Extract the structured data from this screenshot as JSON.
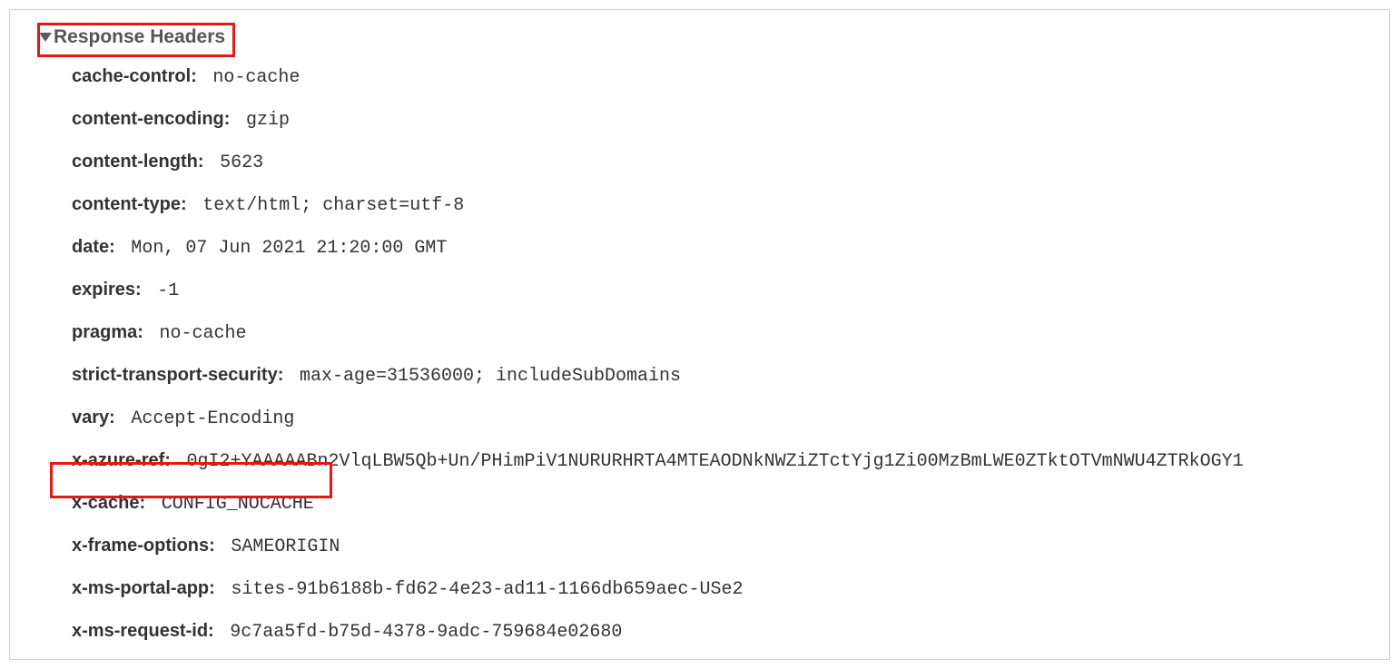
{
  "section": {
    "title": "Response Headers"
  },
  "headers": {
    "h0": {
      "name": "cache-control:",
      "value": "no-cache"
    },
    "h1": {
      "name": "content-encoding:",
      "value": "gzip"
    },
    "h2": {
      "name": "content-length:",
      "value": "5623"
    },
    "h3": {
      "name": "content-type:",
      "value": "text/html; charset=utf-8"
    },
    "h4": {
      "name": "date:",
      "value": "Mon, 07 Jun 2021 21:20:00 GMT"
    },
    "h5": {
      "name": "expires:",
      "value": "-1"
    },
    "h6": {
      "name": "pragma:",
      "value": "no-cache"
    },
    "h7": {
      "name": "strict-transport-security:",
      "value": "max-age=31536000; includeSubDomains"
    },
    "h8": {
      "name": "vary:",
      "value": "Accept-Encoding"
    },
    "h9": {
      "name": "x-azure-ref:",
      "value": "0gI2+YAAAAABn2VlqLBW5Qb+Un/PHimPiV1NURURHRTA4MTEAODNkNWZiZTctYjg1Zi00MzBmLWE0ZTktOTVmNWU4ZTRkOGY1"
    },
    "h10": {
      "name": "x-cache:",
      "value": "CONFIG_NOCACHE"
    },
    "h11": {
      "name": "x-frame-options:",
      "value": "SAMEORIGIN"
    },
    "h12": {
      "name": "x-ms-portal-app:",
      "value": "sites-91b6188b-fd62-4e23-ad11-1166db659aec-USe2"
    },
    "h13": {
      "name": "x-ms-request-id:",
      "value": "9c7aa5fd-b75d-4378-9adc-759684e02680"
    }
  }
}
